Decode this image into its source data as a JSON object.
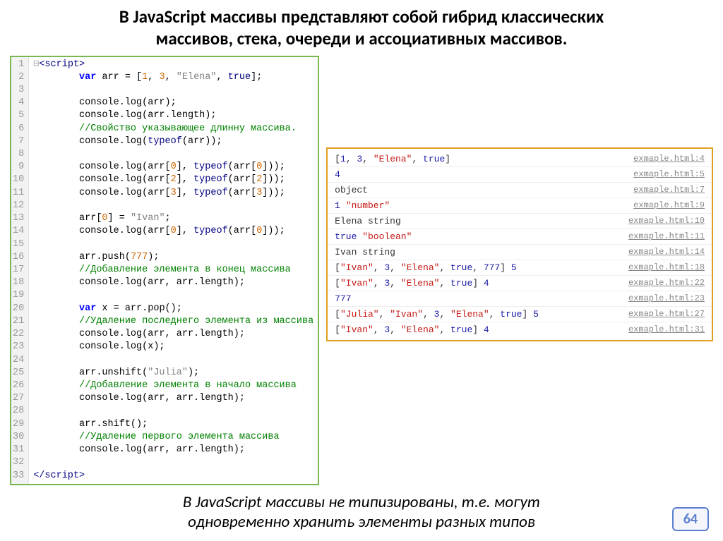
{
  "title_line1": "В JavaScript массивы представляют собой гибрид классических",
  "title_line2": "массивов, стека, очереди и ассоциативных массивов.",
  "footer_line1": "В JavaScript массивы не типизированы, т.е. могут",
  "footer_line2": "одновременно хранить элементы разных типов",
  "page_num": "64",
  "code": {
    "lines": [
      {
        "n": "1",
        "html": "<span class='fold'>⊟</span><span class='tag'>&lt;script&gt;</span>"
      },
      {
        "n": "2",
        "html": "        <span class='kw'>var</span> arr = [<span class='num'>1</span>, <span class='num'>3</span>, <span class='str'>\"Elena\"</span>, <span class='bool'>true</span>];"
      },
      {
        "n": "3",
        "html": ""
      },
      {
        "n": "4",
        "html": "        console.log(arr);"
      },
      {
        "n": "5",
        "html": "        console.log(arr.length);"
      },
      {
        "n": "6",
        "html": "        <span class='cmt'>//Свойство указывающее длинну массива.</span>"
      },
      {
        "n": "7",
        "html": "        console.log(<span class='tf'>typeof</span>(arr));"
      },
      {
        "n": "8",
        "html": ""
      },
      {
        "n": "9",
        "html": "        console.log(arr[<span class='num'>0</span>], <span class='tf'>typeof</span>(arr[<span class='num'>0</span>]));"
      },
      {
        "n": "10",
        "html": "        console.log(arr[<span class='num'>2</span>], <span class='tf'>typeof</span>(arr[<span class='num'>2</span>]));"
      },
      {
        "n": "11",
        "html": "        console.log(arr[<span class='num'>3</span>], <span class='tf'>typeof</span>(arr[<span class='num'>3</span>]));"
      },
      {
        "n": "12",
        "html": ""
      },
      {
        "n": "13",
        "html": "        arr[<span class='num'>0</span>] = <span class='str'>\"Ivan\"</span>;"
      },
      {
        "n": "14",
        "html": "        console.log(arr[<span class='num'>0</span>], <span class='tf'>typeof</span>(arr[<span class='num'>0</span>]));"
      },
      {
        "n": "15",
        "html": ""
      },
      {
        "n": "16",
        "html": "        arr.push(<span class='num'>777</span>);"
      },
      {
        "n": "17",
        "html": "        <span class='cmt'>//Добавление элемента в конец массива</span>"
      },
      {
        "n": "18",
        "html": "        console.log(arr, arr.length);"
      },
      {
        "n": "19",
        "html": ""
      },
      {
        "n": "20",
        "html": "        <span class='kw'>var</span> x = arr.pop();"
      },
      {
        "n": "21",
        "html": "        <span class='cmt'>//Удаление последнего элемента из массива</span>"
      },
      {
        "n": "22",
        "html": "        console.log(arr, arr.length);"
      },
      {
        "n": "23",
        "html": "        console.log(x);"
      },
      {
        "n": "24",
        "html": ""
      },
      {
        "n": "25",
        "html": "        arr.unshift(<span class='str'>\"Julia\"</span>);"
      },
      {
        "n": "26",
        "html": "        <span class='cmt'>//Добавление элемента в начало массива</span>"
      },
      {
        "n": "27",
        "html": "        console.log(arr, arr.length);"
      },
      {
        "n": "28",
        "html": ""
      },
      {
        "n": "29",
        "html": "        arr.shift();"
      },
      {
        "n": "30",
        "html": "        <span class='cmt'>//Удаление первого элемента массива</span>"
      },
      {
        "n": "31",
        "html": "        console.log(arr, arr.length);"
      },
      {
        "n": "32",
        "html": ""
      },
      {
        "n": "33",
        "html": "<span class='tag'>&lt;/script&gt;</span>"
      }
    ]
  },
  "console": [
    {
      "out": "[<span class='n'>1</span>, <span class='n'>3</span>, <span class='s'>\"Elena\"</span>, <span class='k'>true</span>]",
      "src": "exmaple.html:4"
    },
    {
      "out": "<span class='n'>4</span>",
      "src": "exmaple.html:5"
    },
    {
      "out": "object",
      "src": "exmaple.html:7"
    },
    {
      "out": "<span class='n'>1</span> <span class='s'>\"number\"</span>",
      "src": "exmaple.html:9"
    },
    {
      "out": "Elena string",
      "src": "exmaple.html:10"
    },
    {
      "out": "<span class='k'>true</span> <span class='s'>\"boolean\"</span>",
      "src": "exmaple.html:11"
    },
    {
      "out": "Ivan string",
      "src": "exmaple.html:14"
    },
    {
      "out": "[<span class='s'>\"Ivan\"</span>, <span class='n'>3</span>, <span class='s'>\"Elena\"</span>, <span class='k'>true</span>, <span class='n'>777</span>] <span class='n'>5</span>",
      "src": "exmaple.html:18"
    },
    {
      "out": "[<span class='s'>\"Ivan\"</span>, <span class='n'>3</span>, <span class='s'>\"Elena\"</span>, <span class='k'>true</span>] <span class='n'>4</span>",
      "src": "exmaple.html:22"
    },
    {
      "out": "<span class='n'>777</span>",
      "src": "exmaple.html:23"
    },
    {
      "out": "[<span class='s'>\"Julia\"</span>, <span class='s'>\"Ivan\"</span>, <span class='n'>3</span>, <span class='s'>\"Elena\"</span>, <span class='k'>true</span>] <span class='n'>5</span>",
      "src": "exmaple.html:27"
    },
    {
      "out": "[<span class='s'>\"Ivan\"</span>, <span class='n'>3</span>, <span class='s'>\"Elena\"</span>, <span class='k'>true</span>] <span class='n'>4</span>",
      "src": "exmaple.html:31"
    }
  ]
}
